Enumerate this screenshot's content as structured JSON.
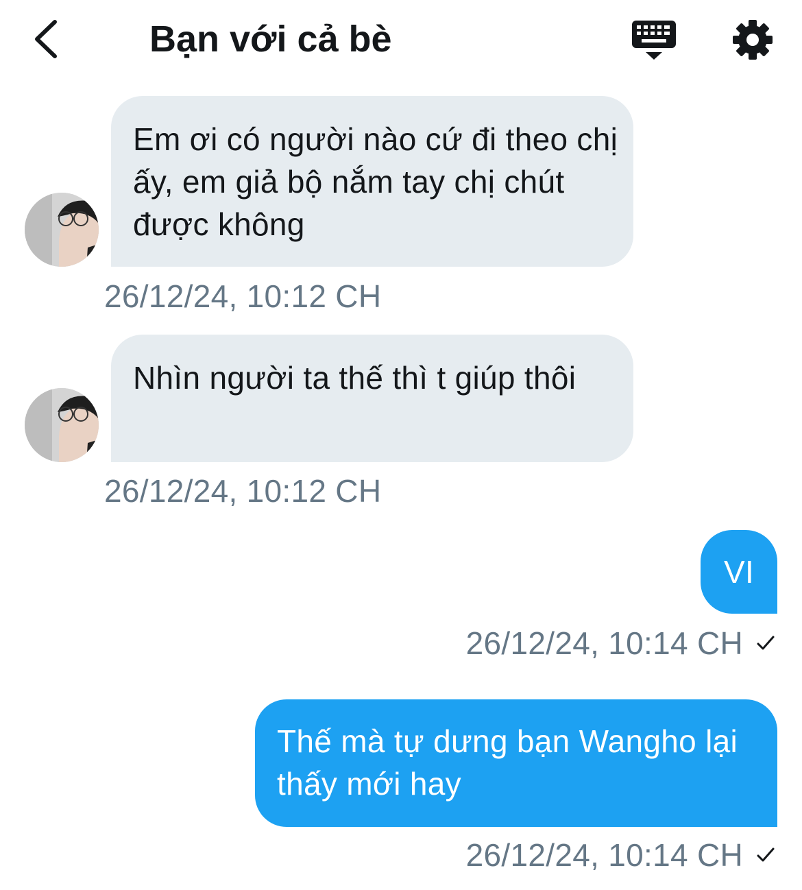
{
  "header": {
    "title": "Bạn với cả bè",
    "back_icon": "chevron-left-icon",
    "keyboard_icon": "keyboard-icon",
    "settings_icon": "gear-icon"
  },
  "messages": [
    {
      "direction": "incoming",
      "text": "Em ơi có người nào cứ đi theo chị ấy, em giả bộ nắm tay chị chút được không",
      "timestamp": "26/12/24, 10:12 CH"
    },
    {
      "direction": "incoming",
      "text": "Nhìn người ta thế thì t giúp thôi",
      "timestamp": "26/12/24, 10:12 CH"
    },
    {
      "direction": "outgoing",
      "text": "VI",
      "timestamp": "26/12/24, 10:14 CH",
      "status_icon": "checkmark-icon"
    },
    {
      "direction": "outgoing",
      "text": "Thế mà tự dưng bạn Wangho lại thấy mới hay",
      "timestamp": "26/12/24, 10:14 CH",
      "status_icon": "checkmark-icon"
    }
  ],
  "colors": {
    "incoming_bubble": "#e6ecf0",
    "outgoing_bubble": "#1da1f2",
    "timestamp_text": "#657786",
    "title_text": "#14171a"
  }
}
